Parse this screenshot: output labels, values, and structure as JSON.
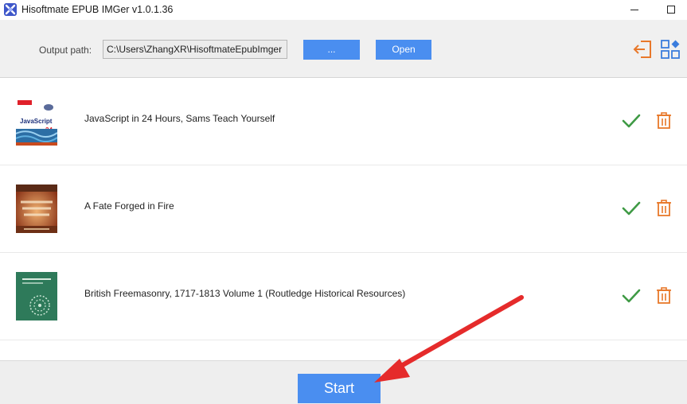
{
  "window": {
    "title": "Hisoftmate EPUB IMGer v1.0.1.36"
  },
  "toolbar": {
    "output_label": "Output path:",
    "output_path": "C:\\Users\\ZhangXR\\HisoftmateEpubImger",
    "browse_label": "...",
    "open_label": "Open",
    "exit_icon": "exit-icon",
    "apps_icon": "apps-icon"
  },
  "books": [
    {
      "title": "JavaScript in 24 Hours, Sams Teach Yourself",
      "cover_text": "JavaScript",
      "cover_number": "24"
    },
    {
      "title": "A Fate Forged in Fire"
    },
    {
      "title": "British Freemasonry, 1717-1813 Volume 1 (Routledge Historical Resources)"
    }
  ],
  "footer": {
    "start_label": "Start"
  },
  "colors": {
    "accent_blue": "#4a8ef0",
    "check_green": "#3f9a45",
    "trash_orange": "#e8782a",
    "annotation_red": "#e52b2b"
  }
}
